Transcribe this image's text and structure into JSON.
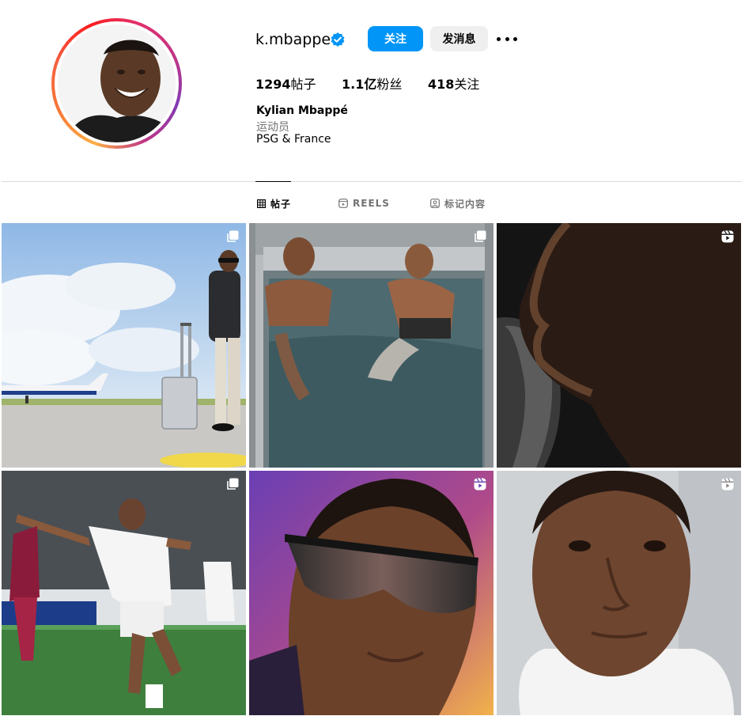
{
  "profile": {
    "username": "k.mbappe",
    "follow_label": "关注",
    "message_label": "发消息",
    "stats": {
      "posts_value": "1294",
      "posts_label": "帖子",
      "followers_value": "1.1亿",
      "followers_label": "粉丝",
      "following_value": "418",
      "following_label": "关注"
    },
    "full_name": "Kylian Mbappé",
    "category": "运动员",
    "bio": "PSG & France"
  },
  "tabs": [
    {
      "label": "帖子",
      "icon": "grid-icon",
      "active": true
    },
    {
      "label": "REELS",
      "icon": "reels-icon",
      "active": false
    },
    {
      "label": "标记内容",
      "icon": "tagged-icon",
      "active": false
    }
  ],
  "posts": [
    {
      "badge": "carousel-icon",
      "subject": "airport-runway-suitcase"
    },
    {
      "badge": "carousel-icon",
      "subject": "ice-bath-two-players"
    },
    {
      "badge": "reels-icon",
      "subject": "profile-portrait-dark"
    },
    {
      "badge": "carousel-icon",
      "subject": "goal-celebration"
    },
    {
      "badge": "reels-icon",
      "subject": "sunglasses-portrait"
    },
    {
      "badge": "reels-icon",
      "subject": "closeup-portrait"
    }
  ],
  "colors": {
    "accent": "#0095f6",
    "secondary_button": "#efefef",
    "muted_text": "#737373",
    "divider": "#dbdbdb"
  }
}
